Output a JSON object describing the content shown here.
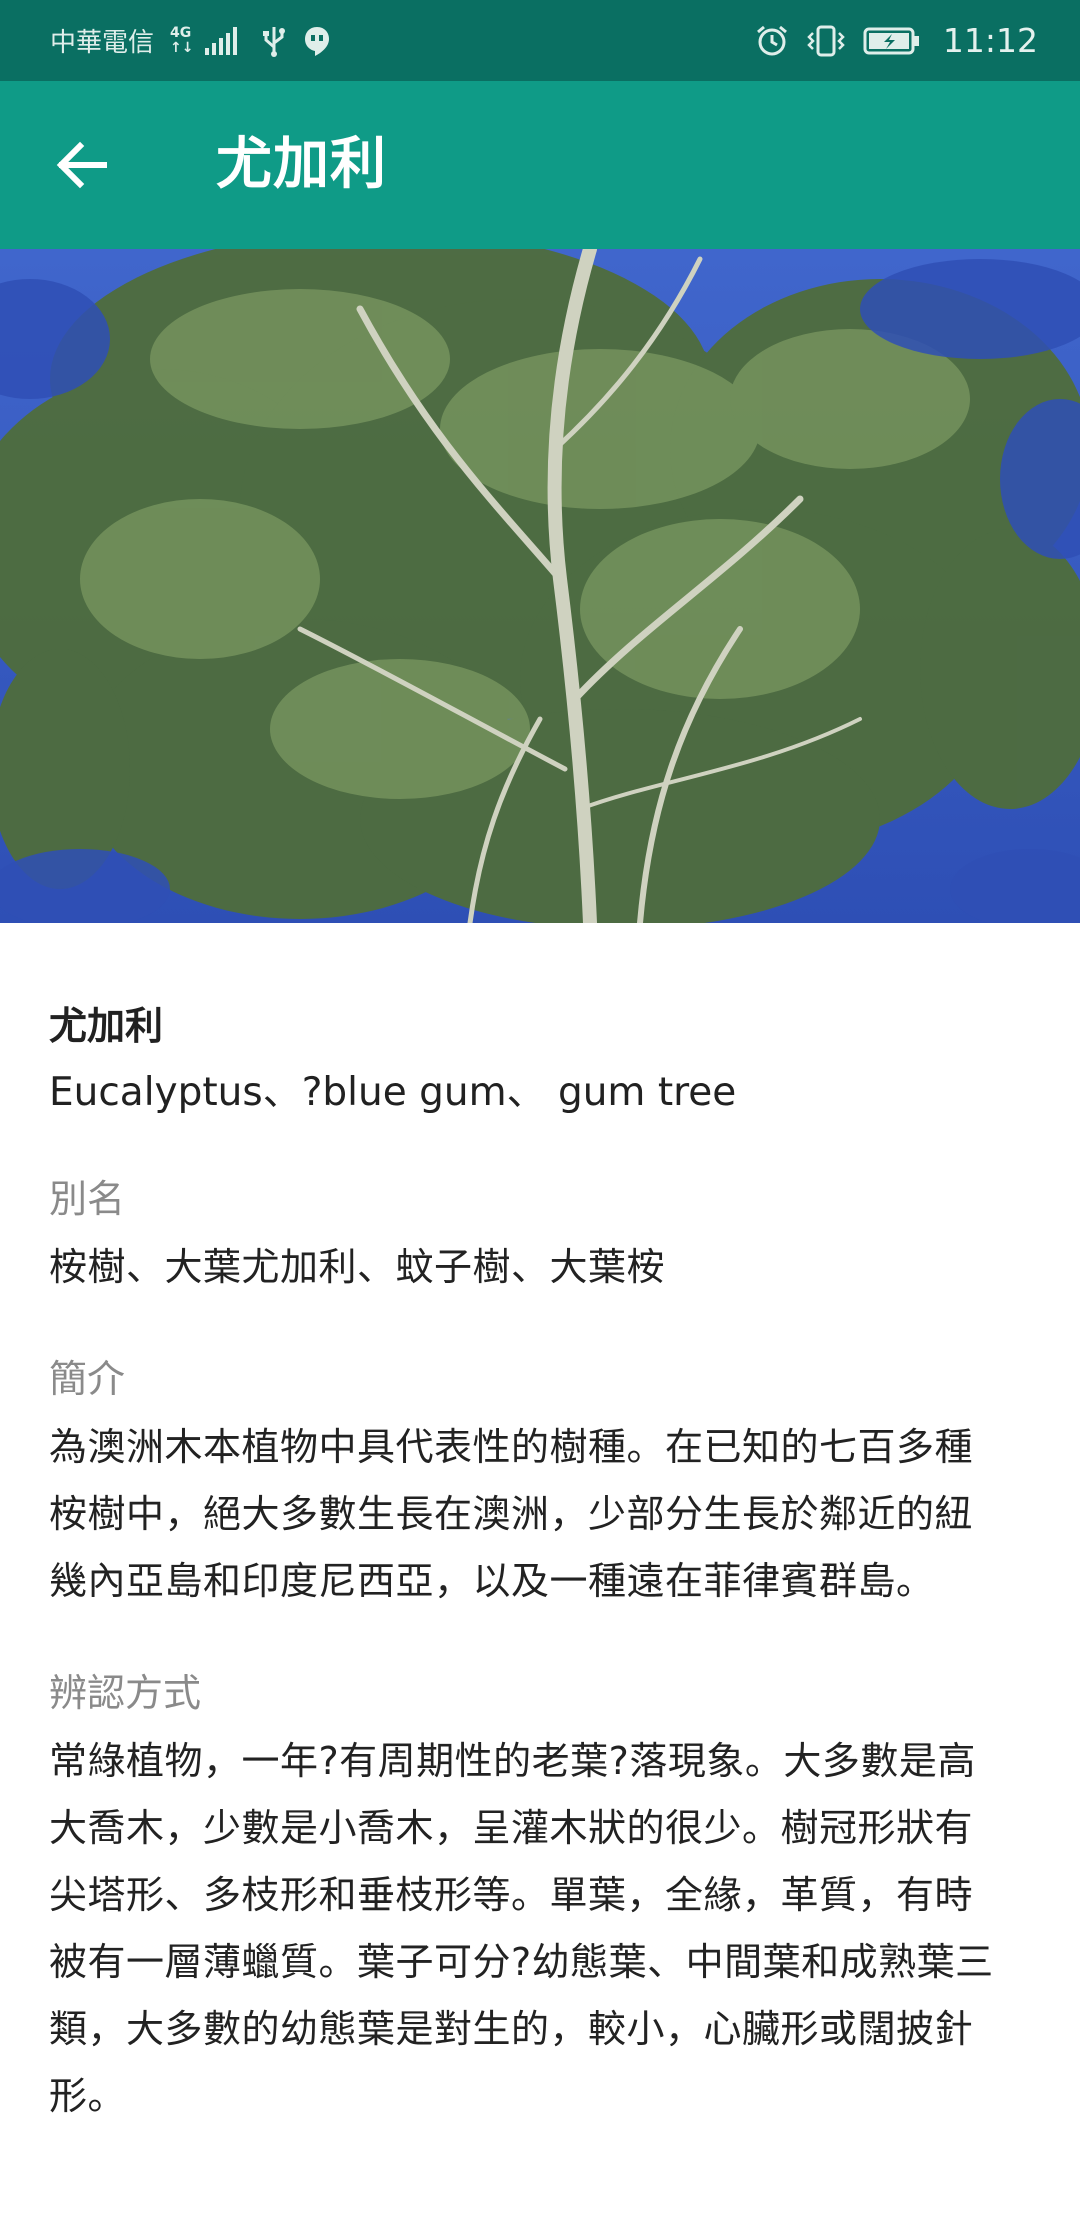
{
  "status_bar": {
    "carrier": "中華電信",
    "network_type_top": "4G",
    "network_type_bottom": "↑↓",
    "time": "11:12",
    "icons": [
      "signal-icon",
      "usb-icon",
      "chat-bubble-icon",
      "alarm-icon",
      "vibrate-icon",
      "battery-charging-icon"
    ]
  },
  "app_bar": {
    "title": "尤加利",
    "back_icon": "arrow-back-icon",
    "background": "#0f9b87",
    "status_background": "#0a6f62"
  },
  "hero_image": {
    "subject": "tree-photo",
    "sky_color": "#3658c2"
  },
  "plant": {
    "name": "尤加利",
    "latin_names": "Eucalyptus、?blue gum、  gum tree"
  },
  "sections": {
    "alias": {
      "label": "別名",
      "text": "桉樹、大葉尤加利、蚊子樹、大葉桉"
    },
    "intro": {
      "label": "簡介",
      "text": "為澳洲木本植物中具代表性的樹種。在已知的七百多種桉樹中，絕大多數生長在澳洲，少部分生長於鄰近的紐幾內亞島和印度尼西亞，以及一種遠在菲律賓群島。"
    },
    "identification": {
      "label": "辨認方式",
      "text": "常綠植物，一年?有周期性的老葉?落現象。大多數是高大喬木，少數是小喬木，呈灌木狀的很少。樹冠形狀有尖塔形、多枝形和垂枝形等。單葉，全緣，革質，有時被有一層薄蠟質。葉子可分?幼態葉、中間葉和成熟葉三類，大多數的幼態葉是對生的，較小，心臟形或闊披針形。"
    }
  }
}
